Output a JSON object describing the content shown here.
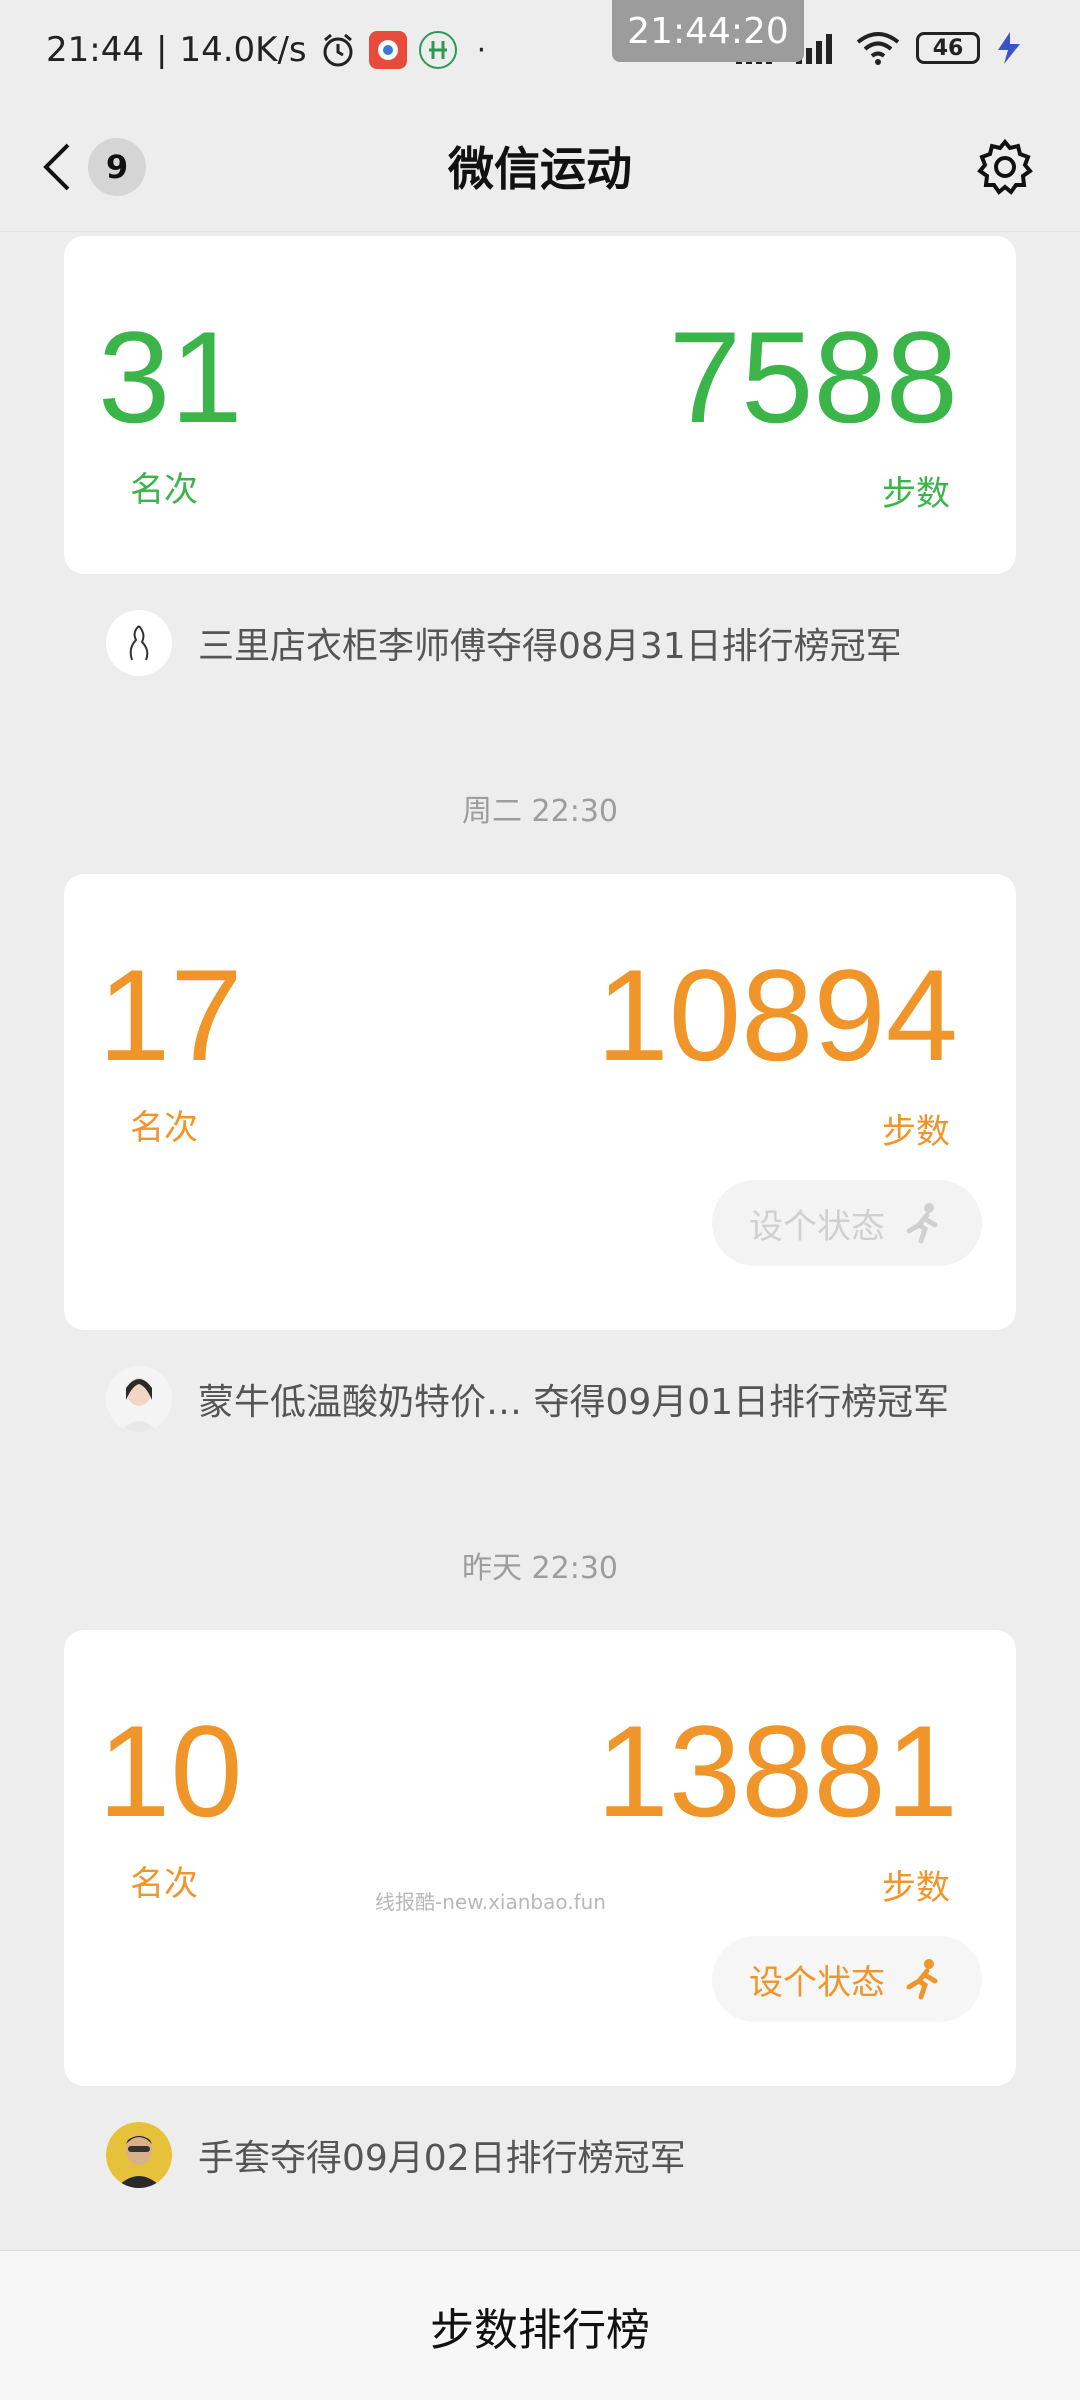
{
  "status_bar": {
    "time": "21:44",
    "network_speed": "14.0K/s",
    "clock_overlay": "21:44:20",
    "battery": "46",
    "icons": [
      "alarm-icon",
      "app-icon-1",
      "app-icon-2",
      "signal-icon",
      "wifi-icon",
      "battery-icon",
      "charging-icon"
    ]
  },
  "header": {
    "back_badge": "9",
    "title": "微信运动"
  },
  "entries": [
    {
      "rank": "31",
      "rank_label": "名次",
      "steps": "7588",
      "steps_label": "步数",
      "color": "#3bb54a",
      "champion_text": "三里店衣柜李师傅夺得08月31日排行榜冠军"
    },
    {
      "timestamp": "周二 22:30",
      "rank": "17",
      "rank_label": "名次",
      "steps": "10894",
      "steps_label": "步数",
      "color": "#f0952a",
      "status_button": "设个状态",
      "status_enabled": false,
      "champion_text": "蒙牛低温酸奶特价… 夺得09月01日排行榜冠军"
    },
    {
      "timestamp": "昨天 22:30",
      "rank": "10",
      "rank_label": "名次",
      "steps": "13881",
      "steps_label": "步数",
      "color": "#f0952a",
      "status_button": "设个状态",
      "status_enabled": true,
      "champion_text": "手套夺得09月02日排行榜冠军"
    }
  ],
  "watermark": "线报酷-new.xianbao.fun",
  "bottom_bar": {
    "label": "步数排行榜"
  }
}
